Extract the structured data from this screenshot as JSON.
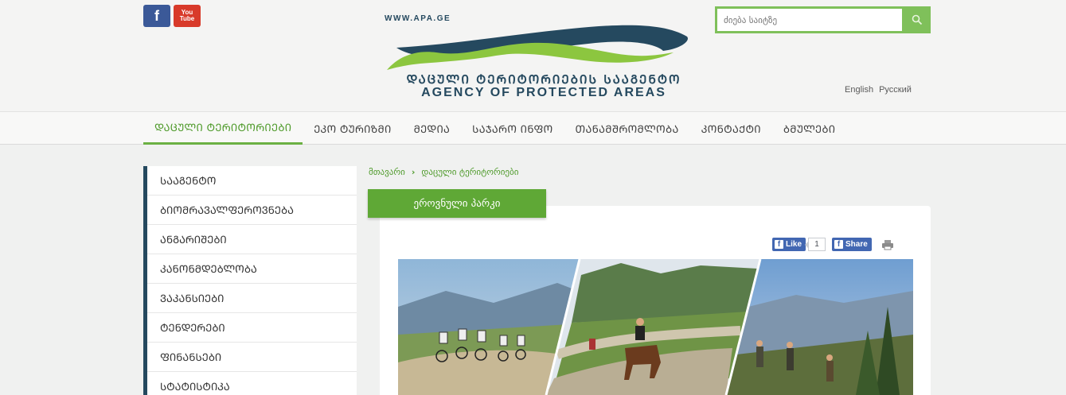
{
  "header": {
    "social": {
      "facebook_glyph": "f",
      "youtube_line1": "You",
      "youtube_line2": "Tube"
    },
    "logo": {
      "url": "WWW.APA.GE",
      "title_geo": "ᲓᲐᲪᲣᲚᲘ ᲢᲔᲠᲘᲢᲝᲠᲘᲔᲑᲘᲡ ᲡᲐᲐᲒᲔᲜᲢᲝ",
      "title_en": "AGENCY OF PROTECTED AREAS",
      "colors": {
        "dark": "#25495f",
        "green": "#8cc63f"
      }
    },
    "search": {
      "placeholder": "ძიება საიტზე"
    },
    "languages": [
      "English",
      "Русский"
    ]
  },
  "nav": {
    "items": [
      {
        "label": "ᲓᲐᲪᲣᲚᲘ ᲢᲔᲠᲘᲢᲝᲠᲘᲔᲑᲘ",
        "active": true
      },
      {
        "label": "ᲔᲙᲝ ᲢᲣᲠᲘᲖᲛᲘ"
      },
      {
        "label": "ᲛᲔᲓᲘᲐ"
      },
      {
        "label": "ᲡᲐᲯᲐᲠᲝ ᲘᲜᲤᲝ"
      },
      {
        "label": "ᲗᲐᲜᲐᲛᲨᲠᲝᲛᲚᲝᲑᲐ"
      },
      {
        "label": "ᲙᲝᲜᲢᲐᲥᲢᲘ"
      },
      {
        "label": "ᲑᲛᲣᲚᲔᲑᲘ"
      }
    ]
  },
  "sidebar": {
    "items": [
      {
        "label": "ᲡᲐᲐᲒᲔᲜᲢᲝ"
      },
      {
        "label": "ᲑᲘᲝᲛᲠᲐᲕᲐᲚᲤᲔᲠᲝᲕᲜᲔᲑᲐ"
      },
      {
        "label": "ᲐᲜᲒᲐᲠᲘᲨᲔᲑᲘ"
      },
      {
        "label": "ᲙᲐᲜᲝᲜᲛᲓᲔᲑᲚᲝᲑᲐ"
      },
      {
        "label": "ᲕᲐᲙᲐᲜᲡᲘᲔᲑᲘ"
      },
      {
        "label": "ᲢᲔᲜᲓᲔᲠᲔᲑᲘ"
      },
      {
        "label": "ᲤᲘᲜᲐᲜᲡᲔᲑᲘ"
      },
      {
        "label": "ᲡᲢᲐᲢᲘᲡᲢᲘᲙᲐ"
      }
    ]
  },
  "breadcrumb": {
    "home": "მთავარი",
    "separator": "›",
    "current": "დაცული ტერიტორიები"
  },
  "page": {
    "tab_title": "ეროვნული პარკი"
  },
  "share": {
    "like_label": "Like",
    "like_count": "1",
    "share_label": "Share",
    "fb_glyph": "f"
  }
}
